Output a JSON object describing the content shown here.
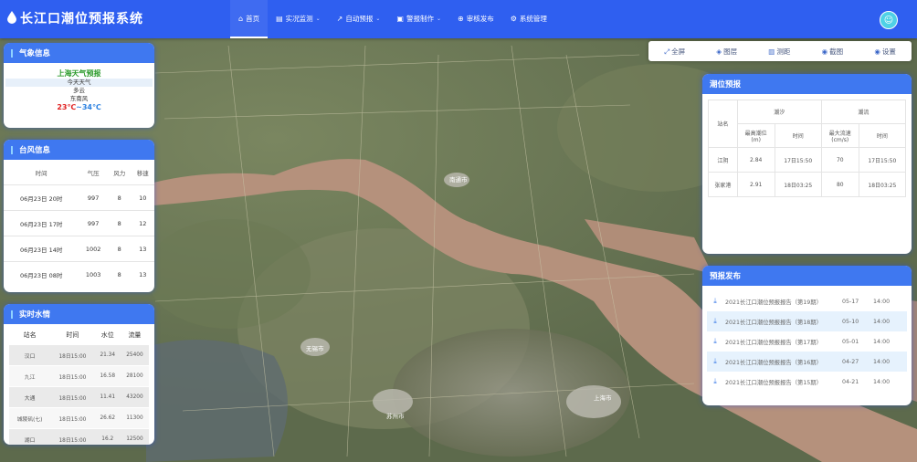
{
  "header": {
    "title": "长江口潮位预报系统",
    "nav": [
      {
        "label": "首页",
        "icon": "home-icon",
        "glyph": "⌂",
        "active": true,
        "caret": ""
      },
      {
        "label": "实况监测",
        "icon": "monitor-icon",
        "glyph": "▤",
        "caret": "⌄"
      },
      {
        "label": "自动预报",
        "icon": "chart-line-icon",
        "glyph": "↗",
        "caret": "⌄"
      },
      {
        "label": "警报制作",
        "icon": "document-icon",
        "glyph": "▣",
        "caret": "⌄"
      },
      {
        "label": "审核发布",
        "icon": "audit-icon",
        "glyph": "⊕",
        "caret": ""
      },
      {
        "label": "系统管理",
        "icon": "gear-icon",
        "glyph": "⚙",
        "caret": ""
      }
    ]
  },
  "toolbar": [
    {
      "label": "全屏",
      "icon": "fullscreen-icon",
      "glyph": "⤢"
    },
    {
      "label": "图层",
      "icon": "layers-icon",
      "glyph": "◈"
    },
    {
      "label": "测距",
      "icon": "ruler-icon",
      "glyph": "▥"
    },
    {
      "label": "截图",
      "icon": "screenshot-icon",
      "glyph": "◉"
    },
    {
      "label": "设置",
      "icon": "settings-icon",
      "glyph": "◉"
    }
  ],
  "weather": {
    "title": "气象信息",
    "city": "上海天气预报",
    "today": "今天天气",
    "condition": "多云",
    "wind": "东南风",
    "temp_low": "23℃",
    "temp_sep": "~",
    "temp_high": "34℃",
    "colors": {
      "low": "#e02020",
      "high": "#2a80e0",
      "city": "#2a9a2a"
    }
  },
  "typhoon": {
    "title": "台风信息",
    "columns": [
      "时间",
      "气压",
      "风力",
      "移速"
    ],
    "rows": [
      [
        "06月23日 20时",
        "997",
        "8",
        "10"
      ],
      [
        "06月23日 17时",
        "997",
        "8",
        "12"
      ],
      [
        "06月23日 14时",
        "1002",
        "8",
        "13"
      ],
      [
        "06月23日 08时",
        "1003",
        "8",
        "13"
      ]
    ]
  },
  "hydro": {
    "title": "实时水情",
    "columns": [
      "站名",
      "时间",
      "水位",
      "流量"
    ],
    "rows": [
      [
        "汉口",
        "18日15:00",
        "21.34",
        "25400"
      ],
      [
        "九江",
        "18日15:00",
        "16.58",
        "28100"
      ],
      [
        "大通",
        "18日15:00",
        "11.41",
        "43200"
      ],
      [
        "城陵矶(七)",
        "18日15:00",
        "26.62",
        "11300"
      ],
      [
        "湖口",
        "18日15:00",
        "16.2",
        "12500"
      ]
    ]
  },
  "tide": {
    "title": "潮位预报",
    "col_station": "站名",
    "group_flood": "潮汐",
    "group_current": "潮流",
    "sub_columns": [
      "最高潮位\n(m)",
      "时间",
      "最大流速\n(cm/s)",
      "时间"
    ],
    "rows": [
      [
        "江阴",
        "2.84",
        "17日15:50",
        "70",
        "17日15:50"
      ],
      [
        "张家港",
        "2.91",
        "18日03:25",
        "80",
        "18日03:25"
      ]
    ]
  },
  "release": {
    "title": "预报发布",
    "items": [
      {
        "name": "2021长江口潮位预报报告（第19期）",
        "date": "05-17",
        "time": "14:00"
      },
      {
        "name": "2021长江口潮位预报报告（第18期）",
        "date": "05-10",
        "time": "14:00"
      },
      {
        "name": "2021长江口潮位预报报告（第17期）",
        "date": "05-01",
        "time": "14:00"
      },
      {
        "name": "2021长江口潮位预报报告（第16期）",
        "date": "04-27",
        "time": "14:00"
      },
      {
        "name": "2021长江口潮位预报报告（第15期）",
        "date": "04-21",
        "time": "14:00"
      }
    ]
  },
  "map": {
    "labels": [
      "南通市",
      "苏州市",
      "无锡市",
      "上海市"
    ]
  }
}
